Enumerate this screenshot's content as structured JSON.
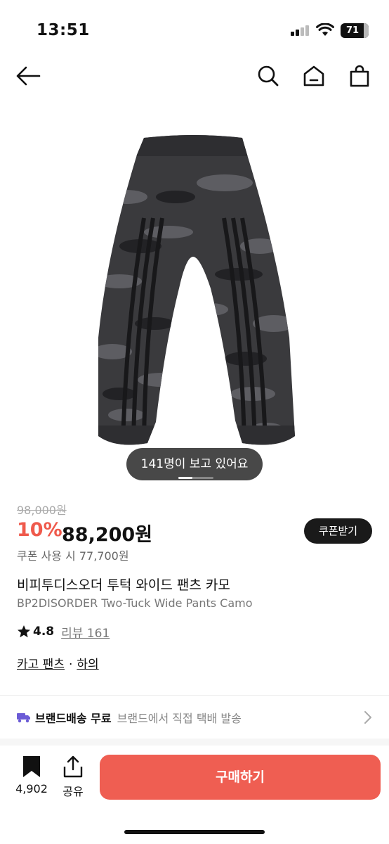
{
  "status_bar": {
    "time": "13:51",
    "battery": "71",
    "battery_level": 0.71
  },
  "nav": {
    "back_icon": "arrow-left-icon",
    "search_icon": "search-icon",
    "home_icon": "home-icon",
    "cart_icon": "shopping-bag-icon"
  },
  "product": {
    "image_icon": "camo-pants-image",
    "viewers": "141명이 보고 있어요",
    "pager_progress": 0.4,
    "original_price": "98,000원",
    "discount": "10%",
    "price": "88,200원",
    "coupon_button": "쿠폰받기",
    "coupon_price": "쿠폰 사용 시 77,700원",
    "title_ko": "비피투디스오더 투턱 와이드 팬츠 카모",
    "title_en": "BP2DISORDER Two-Tuck Wide Pants Camo",
    "rating": "4.8",
    "reviews": "리뷰 161",
    "category_1": "카고 팬츠",
    "category_sep": "·",
    "category_2": "하의"
  },
  "shipping": {
    "icon": "truck-icon",
    "label": "브랜드배송 무료",
    "desc": "브랜드에서 직접 택배 발송"
  },
  "bottom_bar": {
    "save_count": "4,902",
    "share_label": "공유",
    "buy_label": "구매하기"
  },
  "colors": {
    "accent": "#ef5e52",
    "discount": "#ef5a4c",
    "truck": "#6b5bd6"
  }
}
